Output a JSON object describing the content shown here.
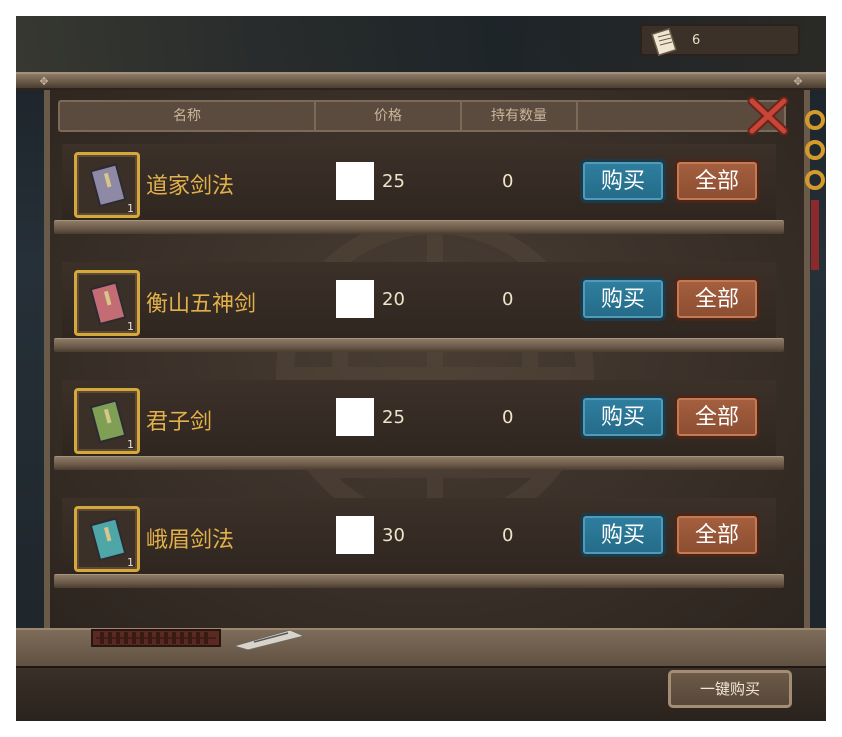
{
  "currency": {
    "icon": "scroll-icon",
    "amount": "6"
  },
  "header": {
    "name_label": "名称",
    "price_label": "价格",
    "held_label": "持有数量",
    "action_label": ""
  },
  "items": [
    {
      "name": "道家剑法",
      "price": "25",
      "held": "0",
      "qty": "1",
      "book_color": "#8e8aa6",
      "buy_label": "购买",
      "all_label": "全部"
    },
    {
      "name": "衡山五神剑",
      "price": "20",
      "held": "0",
      "qty": "1",
      "book_color": "#c46c74",
      "buy_label": "购买",
      "all_label": "全部"
    },
    {
      "name": "君子剑",
      "price": "25",
      "held": "0",
      "qty": "1",
      "book_color": "#7fa054",
      "buy_label": "购买",
      "all_label": "全部"
    },
    {
      "name": "峨眉剑法",
      "price": "30",
      "held": "0",
      "qty": "1",
      "book_color": "#4ea6a6",
      "buy_label": "购买",
      "all_label": "全部"
    }
  ],
  "footer": {
    "bulk_buy_label": "一键购买"
  },
  "colors": {
    "accent_gold": "#e3b14a",
    "buy_blue": "#2f7fa0",
    "all_orange": "#a5603f",
    "close_red": "#c9453a"
  }
}
